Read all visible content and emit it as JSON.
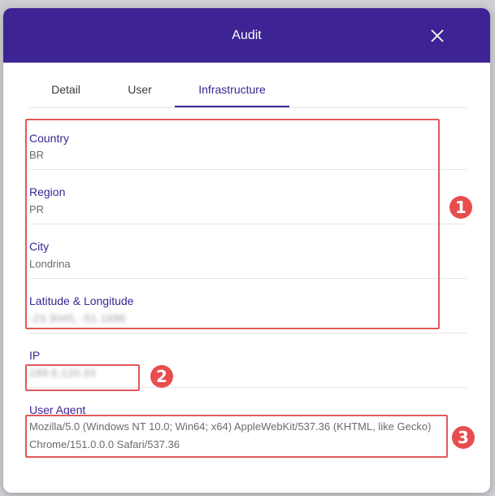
{
  "dialog": {
    "title": "Audit"
  },
  "tabs": [
    {
      "label": "Detail"
    },
    {
      "label": "User"
    },
    {
      "label": "Infrastructure"
    }
  ],
  "fields": {
    "country": {
      "label": "Country",
      "value": "BR"
    },
    "region": {
      "label": "Region",
      "value": "PR"
    },
    "city": {
      "label": "City",
      "value": "Londrina"
    },
    "latlng": {
      "label": "Latitude & Longitude",
      "value": "-23.3045, -51.1696"
    },
    "ip": {
      "label": "IP",
      "value": "189.6.120.33"
    },
    "user_agent": {
      "label": "User Agent",
      "value": "Mozilla/5.0 (Windows NT 10.0; Win64; x64) AppleWebKit/537.36 (KHTML, like Gecko) Chrome/151.0.0.0 Safari/537.36"
    }
  },
  "annotations": [
    {
      "number": "1"
    },
    {
      "number": "2"
    },
    {
      "number": "3"
    }
  ],
  "colors": {
    "header": "#3d2393",
    "label": "#3d2393",
    "highlight": "#e05a5a",
    "marker": "#e84d4d"
  }
}
